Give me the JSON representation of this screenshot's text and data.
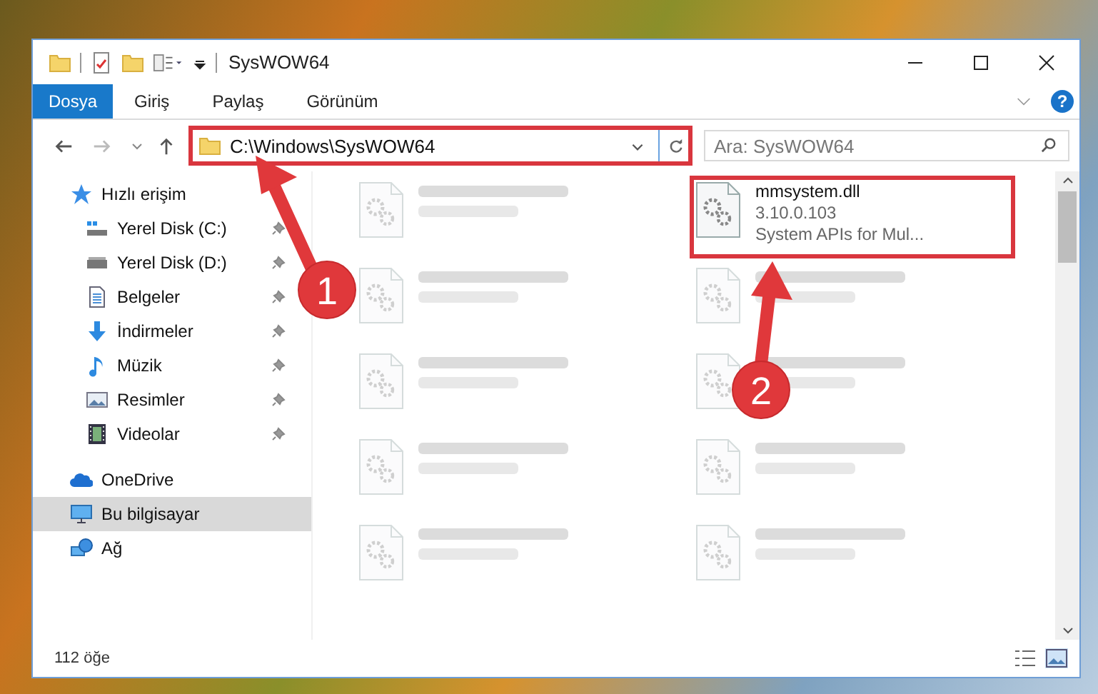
{
  "window": {
    "title": "SysWOW64"
  },
  "ribbon_tabs": [
    {
      "label": "Dosya",
      "kind": "file"
    },
    {
      "label": "Giriş",
      "kind": "tab"
    },
    {
      "label": "Paylaş",
      "kind": "tab"
    },
    {
      "label": "Görünüm",
      "kind": "tab"
    }
  ],
  "help_button": {
    "glyph": "?"
  },
  "address_bar": {
    "path": "C:\\Windows\\SysWOW64",
    "outlined": true
  },
  "search": {
    "placeholder": "Ara: SysWOW64"
  },
  "nav": [
    {
      "label": "Hızlı erişim",
      "kind": "star",
      "selected": false,
      "children": [
        {
          "label": "Yerel Disk (C:)",
          "kind": "drive-win",
          "pinned": true,
          "selected": false
        },
        {
          "label": "Yerel Disk (D:)",
          "kind": "drive",
          "pinned": true,
          "selected": false
        },
        {
          "label": "Belgeler",
          "kind": "docs",
          "pinned": true,
          "selected": false
        },
        {
          "label": "İndirmeler",
          "kind": "download",
          "pinned": true,
          "selected": false
        },
        {
          "label": "Müzik",
          "kind": "music",
          "pinned": true,
          "selected": false
        },
        {
          "label": "Resimler",
          "kind": "pictures",
          "pinned": true,
          "selected": false
        },
        {
          "label": "Videolar",
          "kind": "video",
          "pinned": true,
          "selected": false
        }
      ]
    },
    {
      "label": "OneDrive",
      "kind": "cloud",
      "selected": false
    },
    {
      "label": "Bu bilgisayar",
      "kind": "pc",
      "selected": true
    },
    {
      "label": "Ağ",
      "kind": "network",
      "selected": false
    }
  ],
  "files": [
    {
      "blurred": true
    },
    {
      "name": "mmsystem.dll",
      "details": [
        "3.10.0.103",
        "System APIs for Mul..."
      ],
      "blurred": false,
      "outlined": true
    },
    {
      "blurred": true
    },
    {
      "blurred": true
    },
    {
      "blurred": true
    },
    {
      "blurred": true
    },
    {
      "blurred": true
    },
    {
      "blurred": true
    },
    {
      "blurred": true
    },
    {
      "blurred": true
    }
  ],
  "status_bar": {
    "item_count": "112 öğe"
  },
  "callouts": [
    {
      "number": "1"
    },
    {
      "number": "2"
    }
  ]
}
